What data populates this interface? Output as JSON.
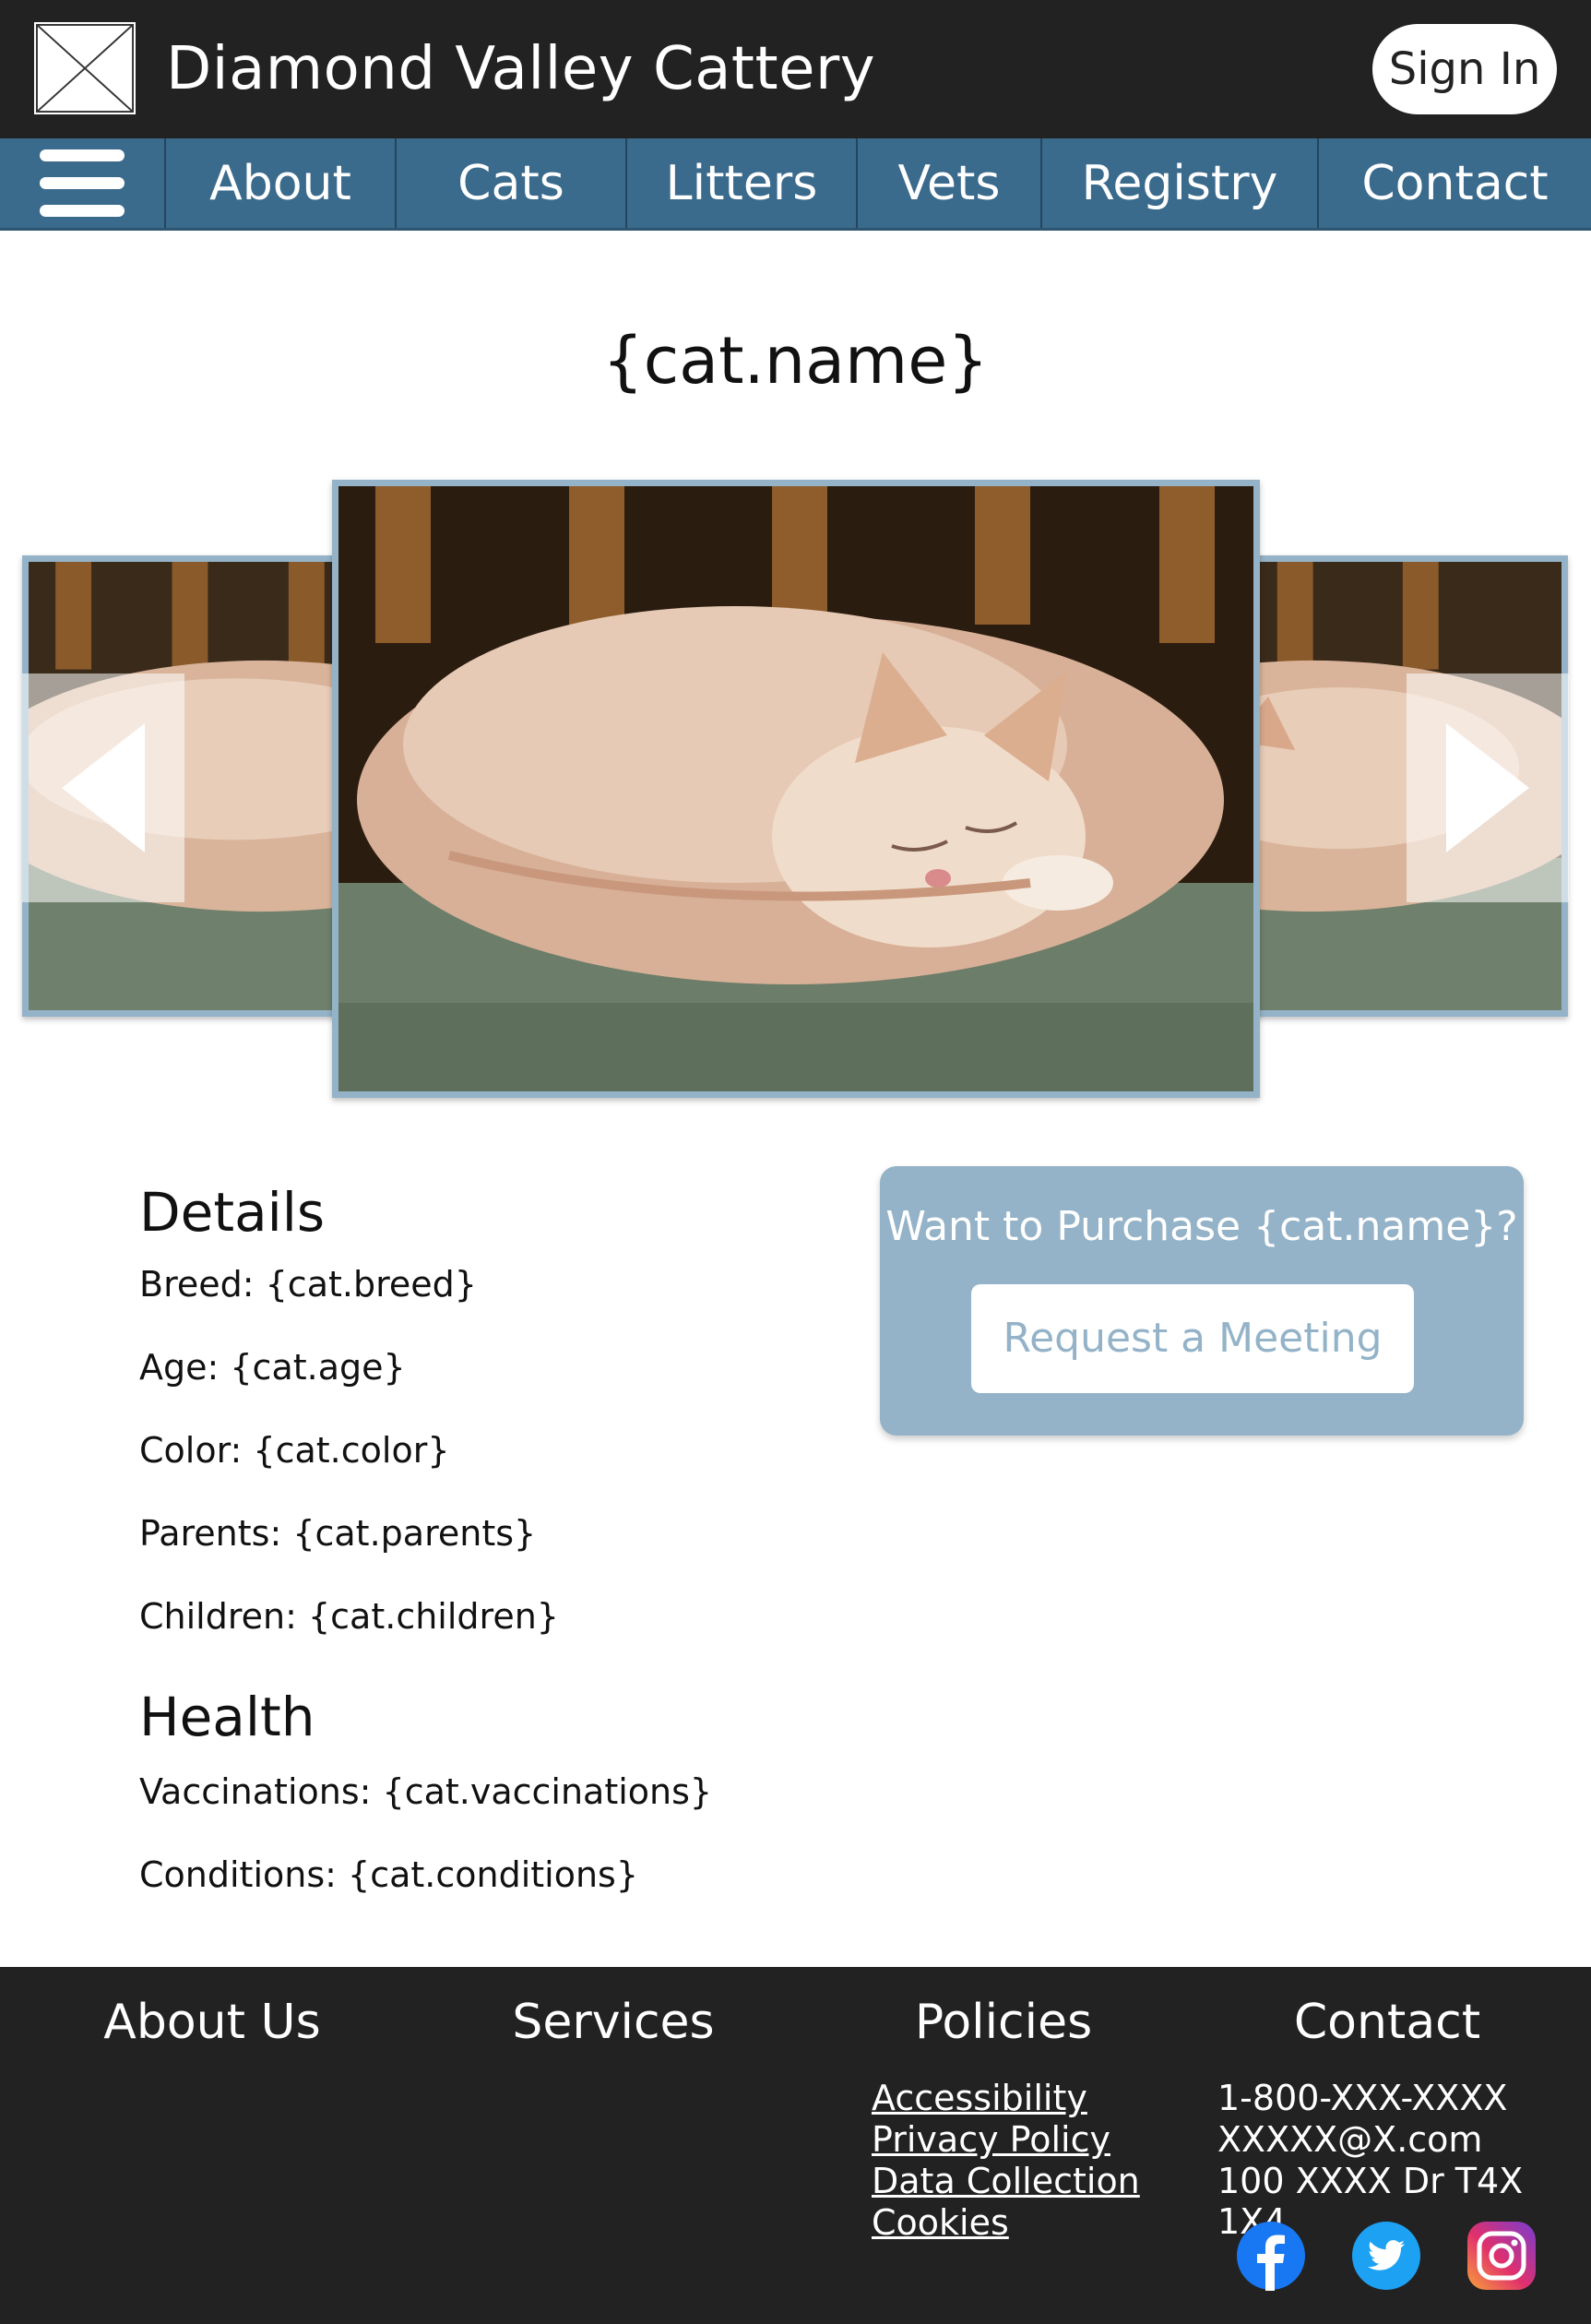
{
  "header": {
    "site_title": "Diamond Valley Cattery",
    "signin_label": "Sign In"
  },
  "nav": {
    "items": [
      "About",
      "Cats",
      "Litters",
      "Vets",
      "Registry",
      "Contact"
    ]
  },
  "cat": {
    "name_heading": "{cat.name}"
  },
  "details": {
    "heading": "Details",
    "rows": [
      "Breed: {cat.breed}",
      "Age: {cat.age}",
      "Color: {cat.color}",
      "Parents: {cat.parents}",
      "Children: {cat.children}"
    ]
  },
  "health": {
    "heading": "Health",
    "rows": [
      "Vaccinations: {cat.vaccinations}",
      "Conditions: {cat.conditions}"
    ]
  },
  "purchase": {
    "title": "Want to Purchase {cat.name}?",
    "button_label": "Request a Meeting"
  },
  "footer": {
    "columns": [
      "About Us",
      "Services",
      "Policies",
      "Contact"
    ],
    "policy_links": [
      "Accessibility",
      "Privacy Policy",
      "Data Collection",
      "Cookies"
    ],
    "contact_lines": [
      "1-800-XXX-XXXX",
      "XXXXX@X.com",
      "100 XXXX Dr T4X 1X4"
    ],
    "social_icons": [
      "facebook-icon",
      "twitter-icon",
      "instagram-icon"
    ]
  },
  "colors": {
    "header_bg": "#222222",
    "nav_bg": "#3a6a8c",
    "accent_light": "#94b3c8",
    "facebook": "#1877f2",
    "twitter": "#1da1f2"
  }
}
